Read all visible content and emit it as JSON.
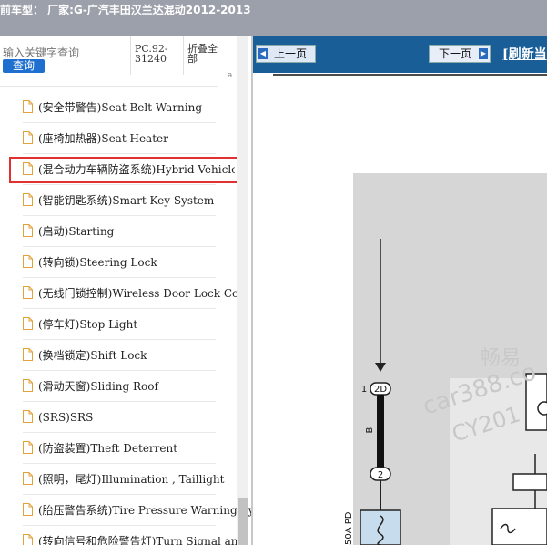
{
  "window": {
    "title": "前车型：  厂家:G-广汽丰田汉兰达混动2012-2013"
  },
  "search": {
    "placeholder": "输入关键字查询",
    "button_label": "查询"
  },
  "header": {
    "pc_code": "PC.92-31240",
    "fold_all": "折叠全部",
    "edge_char": "a"
  },
  "sidebar": {
    "items": [
      {
        "label": "(安全带警告)Seat Belt Warning"
      },
      {
        "label": "(座椅加热器)Seat Heater"
      },
      {
        "label": "(混合动力车辆防盗系统)Hybrid Vehicle"
      },
      {
        "label": "(智能钥匙系统)Smart Key System"
      },
      {
        "label": "(启动)Starting"
      },
      {
        "label": "(转向锁)Steering Lock"
      },
      {
        "label": "(无线门锁控制)Wireless Door Lock Con"
      },
      {
        "label": "(停车灯)Stop Light"
      },
      {
        "label": "(换档锁定)Shift Lock"
      },
      {
        "label": "(滑动天窗)Sliding Roof"
      },
      {
        "label": "(SRS)SRS"
      },
      {
        "label": "(防盗装置)Theft Deterrent"
      },
      {
        "label": "(照明，尾灯)Illumination , Taillight"
      },
      {
        "label": "(胎压警告系统)Tire Pressure Warning Sy"
      },
      {
        "label": "(转向信号和危险警告灯)Turn Signal an"
      }
    ],
    "selected_index": 2
  },
  "toolbar": {
    "prev_label": "上一页",
    "next_label": "下一页",
    "refresh_label": "[刷新当"
  },
  "diagram": {
    "connector_top_pin": "1",
    "connector_top_label": "2D",
    "wire_color_label": "B",
    "connector_bottom_label": "2",
    "fuse_label": "50A PD",
    "watermark_line1": "畅易",
    "watermark_line2": "car388.co",
    "watermark_line3": "CY201"
  }
}
